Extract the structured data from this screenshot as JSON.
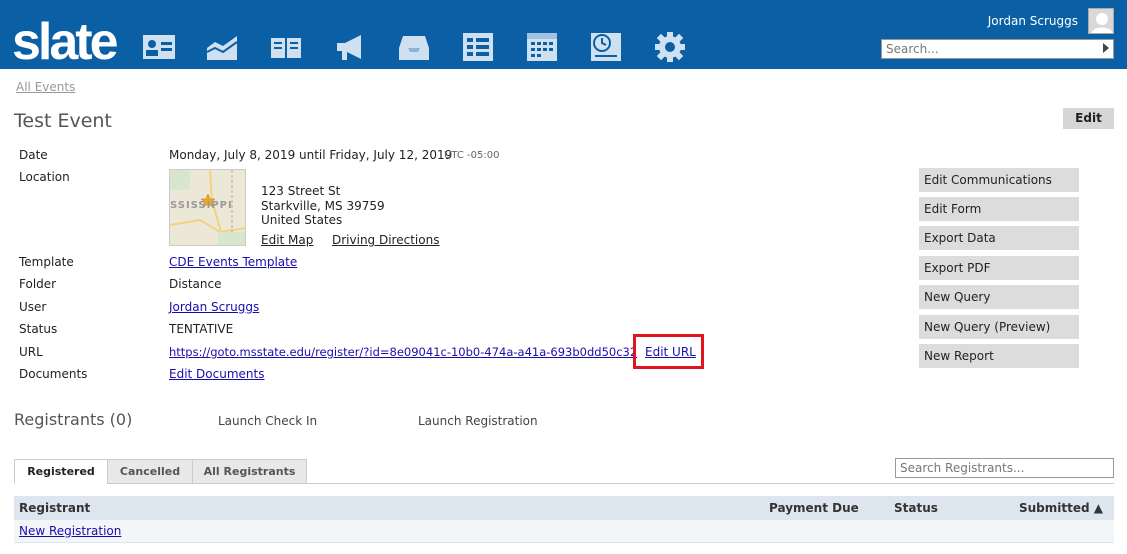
{
  "header": {
    "logo": "slate",
    "user_name": "Jordan Scruggs",
    "search_placeholder": "Search..."
  },
  "breadcrumb": "All Events",
  "event": {
    "title": "Test Event",
    "edit_label": "Edit",
    "date_label": "Date",
    "date_value": "Monday, July 8, 2019 until Friday, July 12, 2019",
    "timezone": "UTC -05:00",
    "location_label": "Location",
    "map_text": "SSISSIPPI",
    "address_line1": "123 Street St",
    "address_line2": "Starkville, MS 39759",
    "address_line3": "United States",
    "edit_map": "Edit Map",
    "driving_directions": "Driving Directions",
    "template_label": "Template",
    "template_value": "CDE Events Template",
    "folder_label": "Folder",
    "folder_value": "Distance",
    "user_label": "User",
    "user_value": "Jordan Scruggs",
    "status_label": "Status",
    "status_value": "TENTATIVE",
    "url_label": "URL",
    "url_value": "https://goto.msstate.edu/register/?id=8e09041c-10b0-474a-a41a-693b0dd50c32",
    "edit_url": "Edit URL",
    "documents_label": "Documents",
    "documents_value": "Edit Documents"
  },
  "side_buttons": [
    "Edit Communications",
    "Edit Form",
    "Export Data",
    "Export PDF",
    "New Query",
    "New Query (Preview)",
    "New Report"
  ],
  "registrants": {
    "title": "Registrants (0)",
    "launch_checkin": "Launch Check In",
    "launch_registration": "Launch Registration",
    "tabs": [
      "Registered",
      "Cancelled",
      "All Registrants"
    ],
    "search_placeholder": "Search Registrants...",
    "columns": {
      "registrant": "Registrant",
      "payment_due": "Payment Due",
      "status": "Status",
      "submitted": "Submitted ▲"
    },
    "new_registration": "New Registration"
  },
  "colors": {
    "header_bg": "#0b5fa4",
    "highlight_border": "#e0141e",
    "link": "#1a0dab"
  }
}
